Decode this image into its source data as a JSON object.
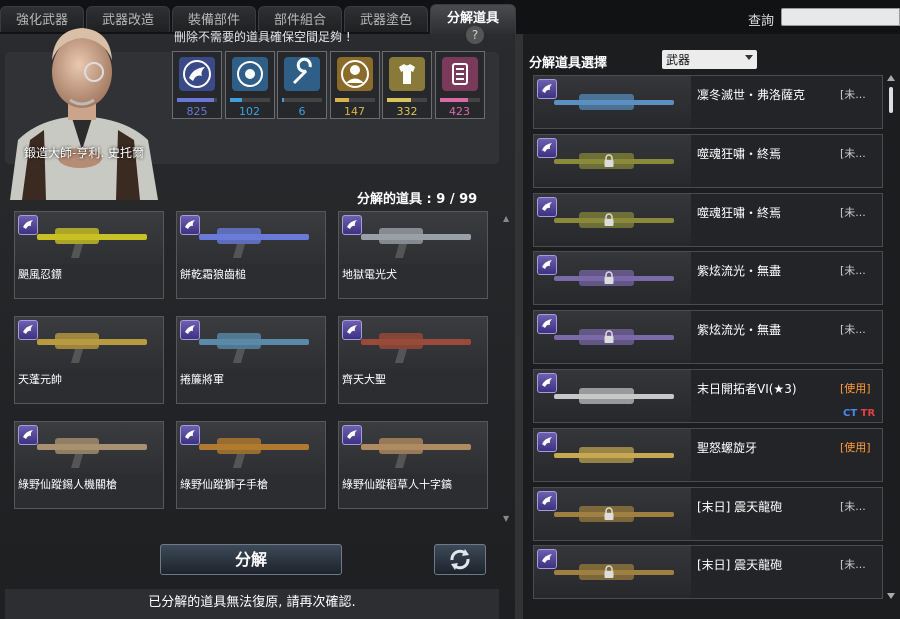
{
  "tabs": [
    "強化武器",
    "武器改造",
    "裝備部件",
    "部件組合",
    "武器塗色",
    "分解道具"
  ],
  "search": {
    "label": "查詢",
    "value": ""
  },
  "master": {
    "name": "鍛造大師-亨利. 史托爾"
  },
  "info_text": "刪除不需要的道具確保空間足夠 !",
  "help": "?",
  "categories": [
    {
      "icon": "weapon-icon",
      "value": "825",
      "fill": 0.92,
      "color": "#6a76d6"
    },
    {
      "icon": "part-icon",
      "value": "102",
      "fill": 0.3,
      "color": "#3fa0e0"
    },
    {
      "icon": "wrench-icon",
      "value": "6",
      "fill": 0.05,
      "color": "#3fa0e0"
    },
    {
      "icon": "character-icon",
      "value": "147",
      "fill": 0.35,
      "color": "#d9b34a"
    },
    {
      "icon": "outfit-icon",
      "value": "332",
      "fill": 0.6,
      "color": "#d9c45a"
    },
    {
      "icon": "list-icon",
      "value": "423",
      "fill": 0.7,
      "color": "#d86aa8"
    }
  ],
  "count_label": "分解的道具 : 9 / 99",
  "grid_items": [
    {
      "name": "颶風忍鏢"
    },
    {
      "name": "餅乾霜狼齒槌"
    },
    {
      "name": "地獄電光犬"
    },
    {
      "name": "天蓬元帥"
    },
    {
      "name": "捲簾將軍"
    },
    {
      "name": "齊天大聖"
    },
    {
      "name": "綠野仙蹤錫人機關槍"
    },
    {
      "name": "綠野仙蹤獅子手槍"
    },
    {
      "name": "綠野仙蹤稻草人十字鎬"
    }
  ],
  "decompose_button": "分解",
  "warning": "已分解的道具無法復原, 請再次確認.",
  "right_panel": {
    "title": "分解道具選擇",
    "filter": "武器",
    "items": [
      {
        "name": "凜冬滅世・弗洛薩克",
        "status": "[未...",
        "locked": false,
        "ctr": false
      },
      {
        "name": "噬魂狂嘯・終焉",
        "status": "[未...",
        "locked": true,
        "ctr": false
      },
      {
        "name": "噬魂狂嘯・終焉",
        "status": "[未...",
        "locked": true,
        "ctr": false
      },
      {
        "name": "紫炫流光・無盡",
        "status": "[未...",
        "locked": true,
        "ctr": false
      },
      {
        "name": "紫炫流光・無盡",
        "status": "[未...",
        "locked": true,
        "ctr": false
      },
      {
        "name": "末日開拓者VI(★3)",
        "status": "[使用]",
        "locked": false,
        "ctr": true
      },
      {
        "name": "聖怒螺旋牙",
        "status": "[使用]",
        "locked": false,
        "ctr": false
      },
      {
        "name": "[末日] 震天龍砲",
        "status": "[未...",
        "locked": true,
        "ctr": false
      },
      {
        "name": "[末日] 震天龍砲",
        "status": "[未...",
        "locked": true,
        "ctr": false
      }
    ],
    "ct_label": "CT",
    "tr_label": "TR"
  }
}
